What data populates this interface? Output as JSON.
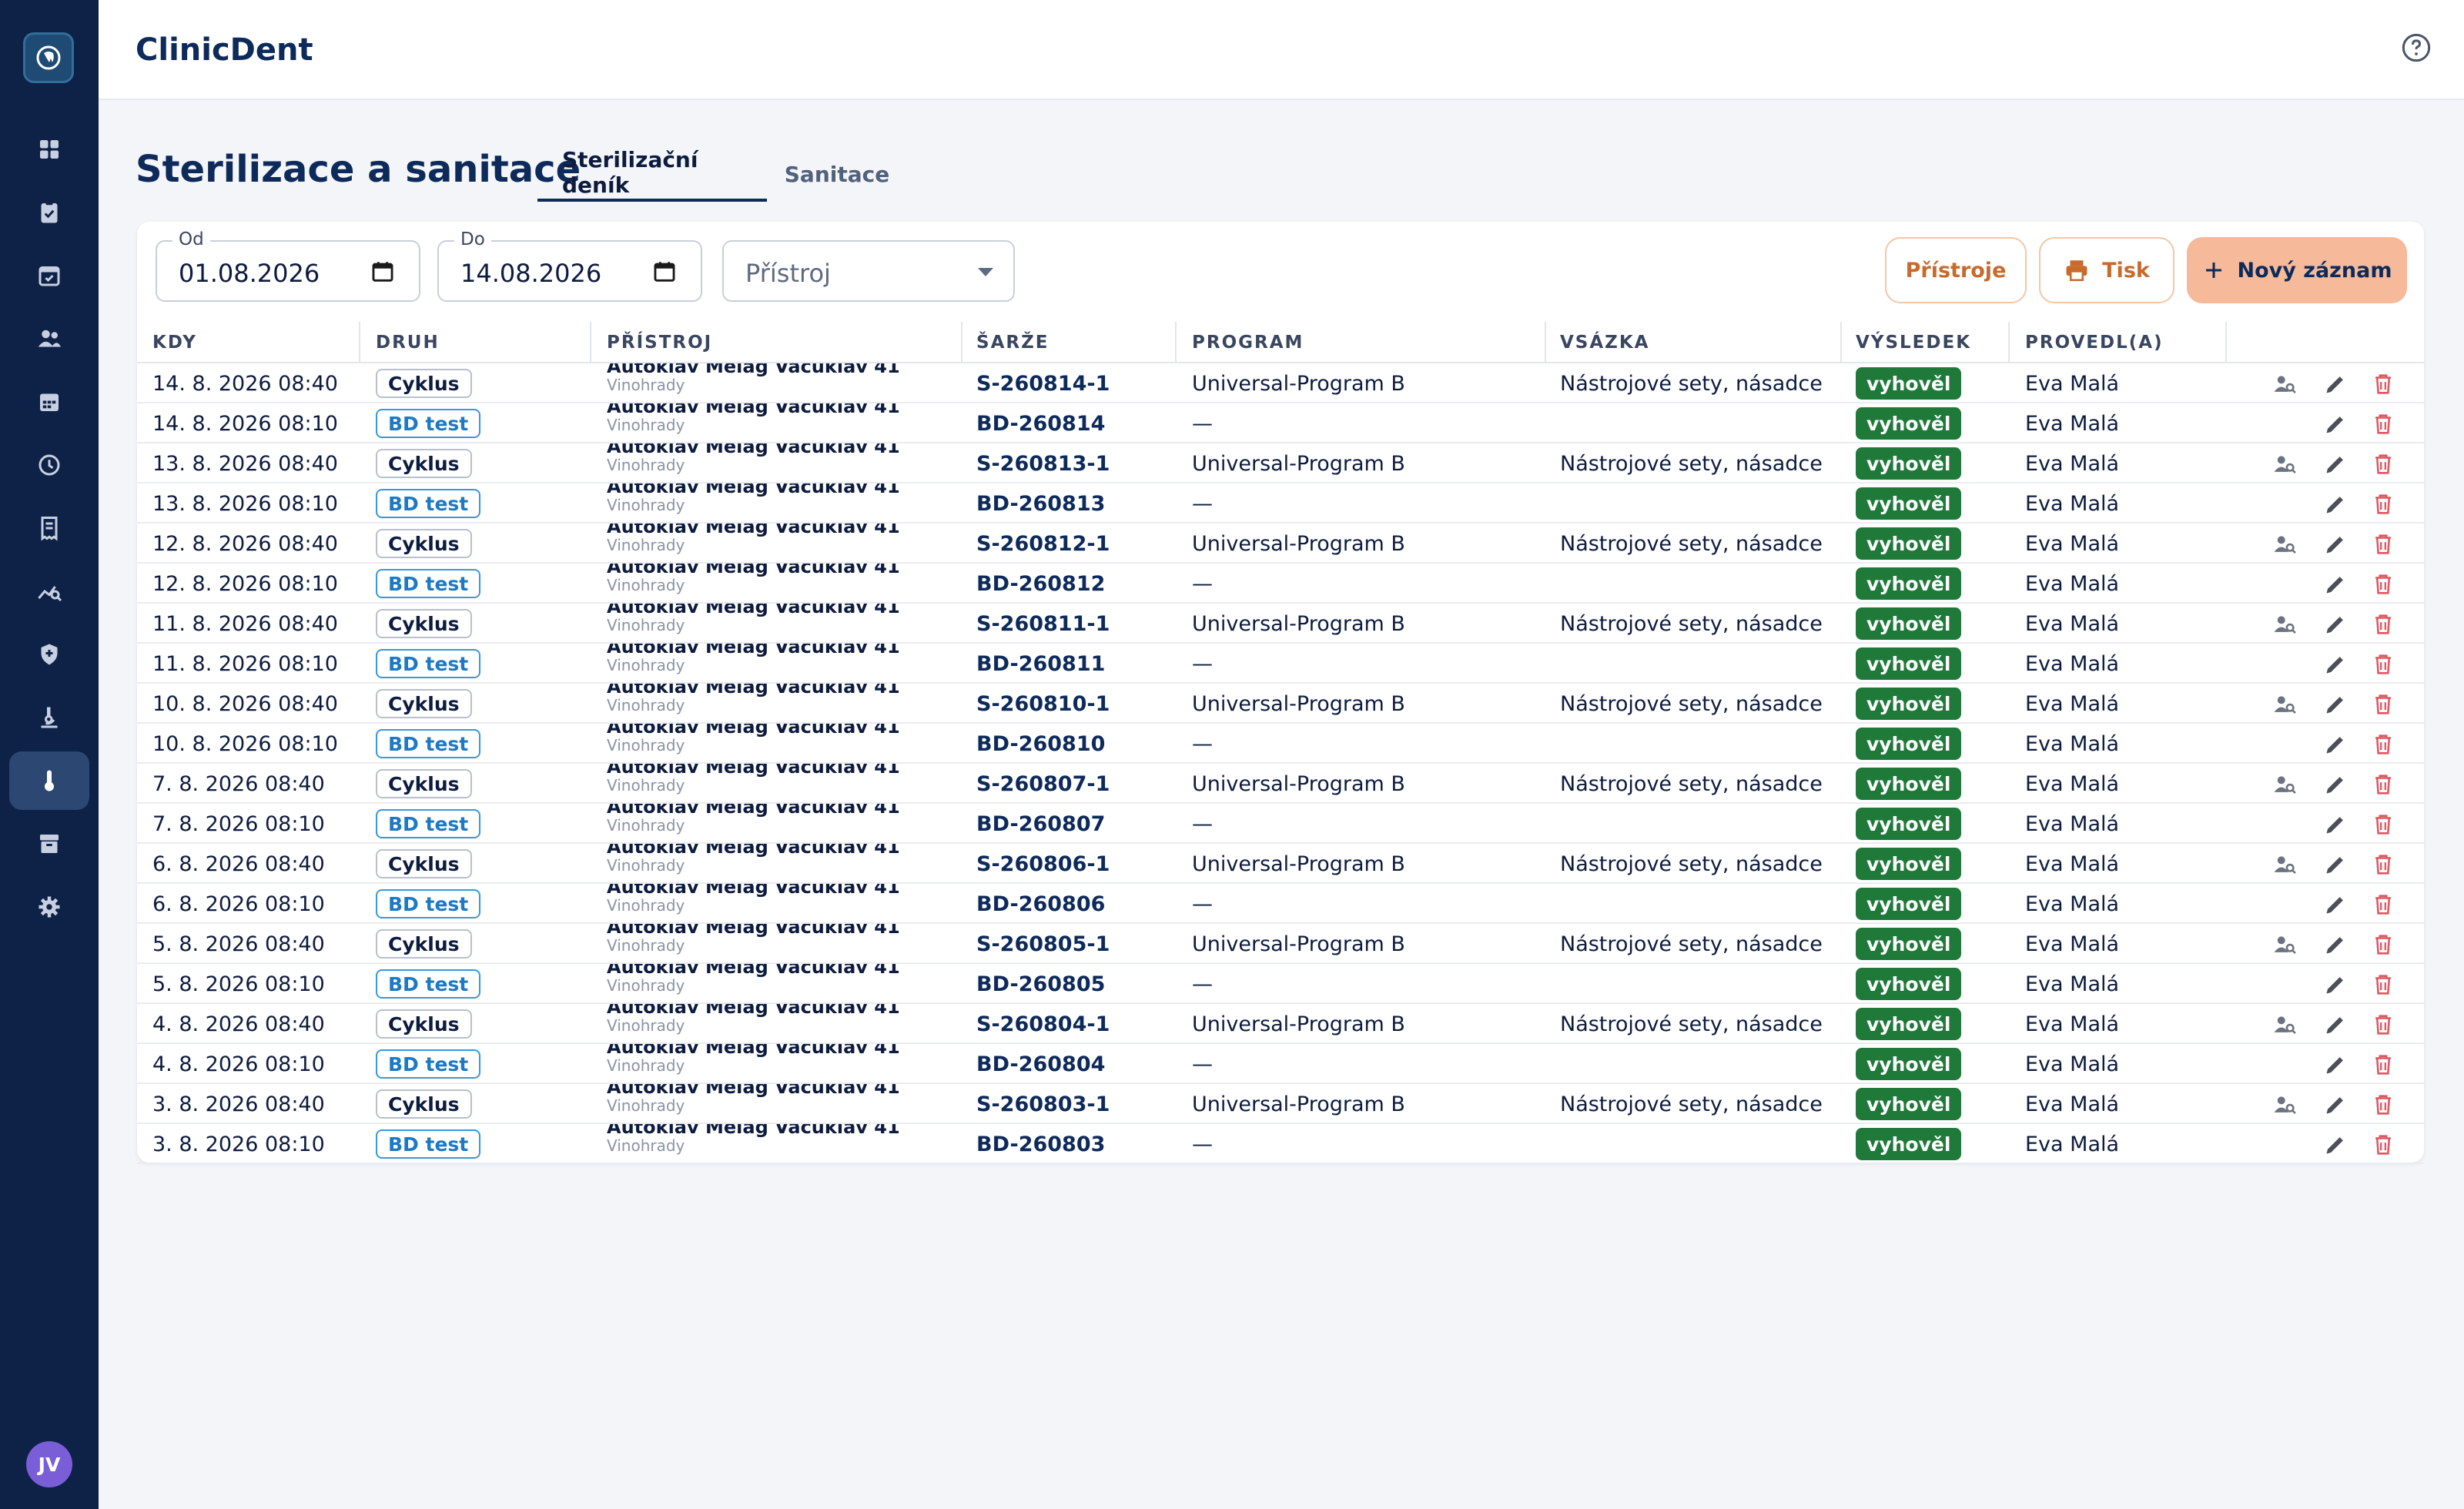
{
  "app": {
    "title": "ClinicDent",
    "user_initials": "JV"
  },
  "sidebar": {
    "logo_icon": "tooth-icon",
    "items": [
      {
        "icon": "dashboard-icon"
      },
      {
        "icon": "clipboard-check-icon"
      },
      {
        "icon": "calendar-check-icon"
      },
      {
        "icon": "people-icon"
      },
      {
        "icon": "calendar-icon"
      },
      {
        "icon": "clock-icon"
      },
      {
        "icon": "receipt-icon"
      },
      {
        "icon": "analytics-icon"
      },
      {
        "icon": "shield-icon"
      },
      {
        "icon": "microscope-icon"
      },
      {
        "icon": "thermometer-icon",
        "active": true
      },
      {
        "icon": "archive-icon"
      },
      {
        "icon": "gear-icon"
      }
    ]
  },
  "page": {
    "title": "Sterilizace a sanitace",
    "tabs": [
      {
        "label": "Sterilizační deník",
        "active": true
      },
      {
        "label": "Sanitace",
        "active": false
      }
    ]
  },
  "filters": {
    "from_label": "Od",
    "from_value": "01.08.2026",
    "to_label": "Do",
    "to_value": "14.08.2026",
    "device_placeholder": "Přístroj"
  },
  "toolbar": {
    "devices_label": "Přístroje",
    "print_label": "Tisk",
    "new_label": "Nový záznam"
  },
  "table": {
    "headers": [
      "KDY",
      "DRUH",
      "PŘÍSTROJ",
      "ŠARŽE",
      "PROGRAM",
      "VSÁZKA",
      "VÝSLEDEK",
      "PROVEDL(A)"
    ],
    "device_name": "Autokláv Melag Vacuklav 41",
    "device_location": "Vinohrady",
    "rows": [
      {
        "when": "14. 8. 2026 08:40",
        "type": "Cyklus",
        "batch": "S-260814-1",
        "program": "Universal-Program B",
        "load": "Nástrojové sety, násadce",
        "result": "vyhověl",
        "by": "Eva Malá"
      },
      {
        "when": "14. 8. 2026 08:10",
        "type": "BD test",
        "batch": "BD-260814",
        "program": "—",
        "load": "",
        "result": "vyhověl",
        "by": "Eva Malá"
      },
      {
        "when": "13. 8. 2026 08:40",
        "type": "Cyklus",
        "batch": "S-260813-1",
        "program": "Universal-Program B",
        "load": "Nástrojové sety, násadce",
        "result": "vyhověl",
        "by": "Eva Malá"
      },
      {
        "when": "13. 8. 2026 08:10",
        "type": "BD test",
        "batch": "BD-260813",
        "program": "—",
        "load": "",
        "result": "vyhověl",
        "by": "Eva Malá"
      },
      {
        "when": "12. 8. 2026 08:40",
        "type": "Cyklus",
        "batch": "S-260812-1",
        "program": "Universal-Program B",
        "load": "Nástrojové sety, násadce",
        "result": "vyhověl",
        "by": "Eva Malá"
      },
      {
        "when": "12. 8. 2026 08:10",
        "type": "BD test",
        "batch": "BD-260812",
        "program": "—",
        "load": "",
        "result": "vyhověl",
        "by": "Eva Malá"
      },
      {
        "when": "11. 8. 2026 08:40",
        "type": "Cyklus",
        "batch": "S-260811-1",
        "program": "Universal-Program B",
        "load": "Nástrojové sety, násadce",
        "result": "vyhověl",
        "by": "Eva Malá"
      },
      {
        "when": "11. 8. 2026 08:10",
        "type": "BD test",
        "batch": "BD-260811",
        "program": "—",
        "load": "",
        "result": "vyhověl",
        "by": "Eva Malá"
      },
      {
        "when": "10. 8. 2026 08:40",
        "type": "Cyklus",
        "batch": "S-260810-1",
        "program": "Universal-Program B",
        "load": "Nástrojové sety, násadce",
        "result": "vyhověl",
        "by": "Eva Malá"
      },
      {
        "when": "10. 8. 2026 08:10",
        "type": "BD test",
        "batch": "BD-260810",
        "program": "—",
        "load": "",
        "result": "vyhověl",
        "by": "Eva Malá"
      },
      {
        "when": "7. 8. 2026 08:40",
        "type": "Cyklus",
        "batch": "S-260807-1",
        "program": "Universal-Program B",
        "load": "Nástrojové sety, násadce",
        "result": "vyhověl",
        "by": "Eva Malá"
      },
      {
        "when": "7. 8. 2026 08:10",
        "type": "BD test",
        "batch": "BD-260807",
        "program": "—",
        "load": "",
        "result": "vyhověl",
        "by": "Eva Malá"
      },
      {
        "when": "6. 8. 2026 08:40",
        "type": "Cyklus",
        "batch": "S-260806-1",
        "program": "Universal-Program B",
        "load": "Nástrojové sety, násadce",
        "result": "vyhověl",
        "by": "Eva Malá"
      },
      {
        "when": "6. 8. 2026 08:10",
        "type": "BD test",
        "batch": "BD-260806",
        "program": "—",
        "load": "",
        "result": "vyhověl",
        "by": "Eva Malá"
      },
      {
        "when": "5. 8. 2026 08:40",
        "type": "Cyklus",
        "batch": "S-260805-1",
        "program": "Universal-Program B",
        "load": "Nástrojové sety, násadce",
        "result": "vyhověl",
        "by": "Eva Malá"
      },
      {
        "when": "5. 8. 2026 08:10",
        "type": "BD test",
        "batch": "BD-260805",
        "program": "—",
        "load": "",
        "result": "vyhověl",
        "by": "Eva Malá"
      },
      {
        "when": "4. 8. 2026 08:40",
        "type": "Cyklus",
        "batch": "S-260804-1",
        "program": "Universal-Program B",
        "load": "Nástrojové sety, násadce",
        "result": "vyhověl",
        "by": "Eva Malá"
      },
      {
        "when": "4. 8. 2026 08:10",
        "type": "BD test",
        "batch": "BD-260804",
        "program": "—",
        "load": "",
        "result": "vyhověl",
        "by": "Eva Malá"
      },
      {
        "when": "3. 8. 2026 08:40",
        "type": "Cyklus",
        "batch": "S-260803-1",
        "program": "Universal-Program B",
        "load": "Nástrojové sety, násadce",
        "result": "vyhověl",
        "by": "Eva Malá"
      },
      {
        "when": "3. 8. 2026 08:10",
        "type": "BD test",
        "batch": "BD-260803",
        "program": "—",
        "load": "",
        "result": "vyhověl",
        "by": "Eva Malá"
      }
    ]
  },
  "colors": {
    "sidebar_bg": "#0e2147",
    "primary_navy": "#0d2a5a",
    "accent_orange": "#f6b99a",
    "success_green": "#1f7a3a",
    "bd_blue": "#1d79c2",
    "delete_red": "#e0565f"
  }
}
